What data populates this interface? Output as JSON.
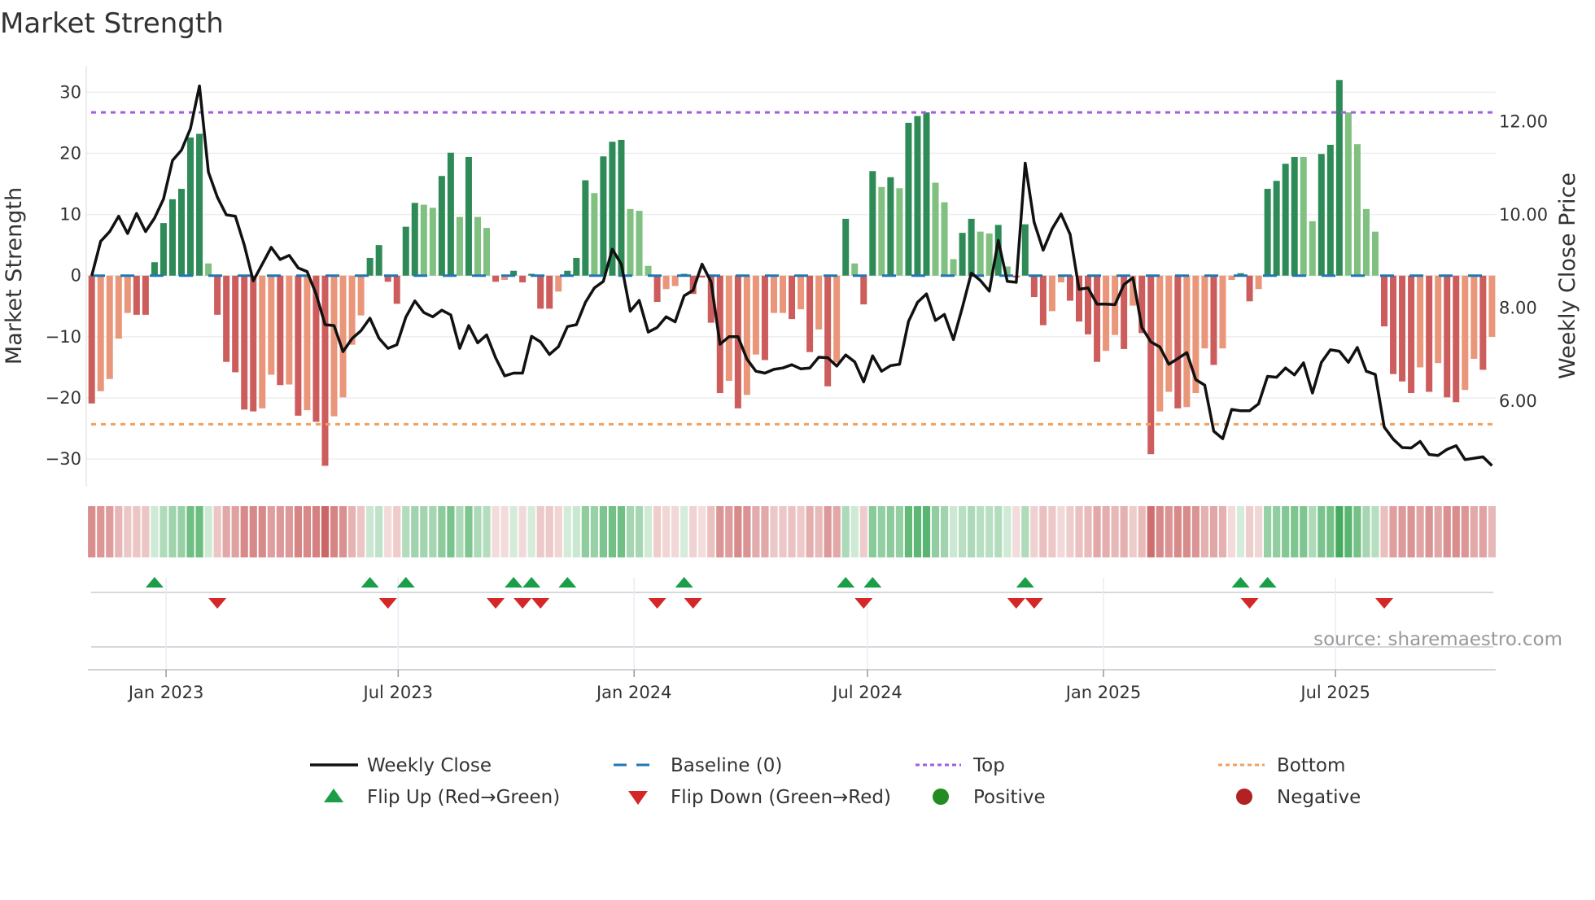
{
  "chart_data": {
    "type": "bar",
    "title": "Market Strength",
    "ylabel": "Market Strength",
    "y2label": "Weekly Close Price",
    "ylim": [
      -34.5,
      34.3
    ],
    "y2lim": [
      4.16,
      13.2
    ],
    "yticks": [
      "30",
      "20",
      "10",
      "0",
      "−10",
      "−20",
      "−30"
    ],
    "ytick_values": [
      30,
      20,
      10,
      0,
      -10,
      -20,
      -30
    ],
    "y2ticks": [
      "12.00",
      "10.00",
      "8.00",
      "6.00"
    ],
    "y2tick_values": [
      12,
      10,
      8,
      6
    ],
    "xticks": [
      "Jan 2023",
      "Jul 2023",
      "Jan 2024",
      "Jul 2024",
      "Jan 2025",
      "Jul 2025"
    ],
    "xtick_dates": [
      "2023-01-01",
      "2023-07-01",
      "2024-01-01",
      "2024-07-01",
      "2025-01-01",
      "2025-07-01"
    ],
    "first_week": "2022-11-04",
    "grid": true,
    "top_level": 26.7,
    "bottom_level": -24.3,
    "baseline": 0,
    "strength": [
      -20.9,
      -18.9,
      -16.9,
      -10.3,
      -6.1,
      -6.4,
      -6.4,
      2.2,
      8.6,
      12.5,
      14.2,
      22.6,
      23.2,
      2.0,
      -6.4,
      -14.1,
      -15.8,
      -21.9,
      -22.2,
      -21.7,
      -16.2,
      -17.9,
      -17.8,
      -22.9,
      -22.0,
      -23.9,
      -31.1,
      -23.0,
      -19.9,
      -11.3,
      -6.5,
      2.9,
      5.0,
      -1.0,
      -4.6,
      8.0,
      11.9,
      11.6,
      11.1,
      16.3,
      20.1,
      9.6,
      19.4,
      9.6,
      7.8,
      -1.0,
      -0.7,
      0.8,
      -1.1,
      0.3,
      -5.4,
      -5.4,
      -2.6,
      0.8,
      2.9,
      15.6,
      13.5,
      19.5,
      21.9,
      22.2,
      10.9,
      10.6,
      1.6,
      -4.3,
      -2.2,
      -1.7,
      0.3,
      -3.0,
      -0.3,
      -7.7,
      -19.2,
      -17.2,
      -21.7,
      -19.5,
      -12.9,
      -13.8,
      -6.1,
      -6.1,
      -7.1,
      -5.5,
      -12.5,
      -8.8,
      -18.1,
      -14.2,
      9.3,
      2.0,
      -4.7,
      17.1,
      14.5,
      16.1,
      14.3,
      25.0,
      26.1,
      26.7,
      15.2,
      12.0,
      2.7,
      7.0,
      9.3,
      7.2,
      6.9,
      8.3,
      1.5,
      -0.3,
      8.4,
      -3.5,
      -8.1,
      -5.8,
      -1.1,
      -4.1,
      -7.5,
      -9.6,
      -14.1,
      -12.3,
      -9.7,
      -12.0,
      -4.9,
      -9.4,
      -29.2,
      -22.2,
      -19.0,
      -21.7,
      -21.5,
      -19.2,
      -11.9,
      -14.6,
      -11.9,
      -0.7,
      0.4,
      -4.2,
      -2.2,
      14.2,
      15.5,
      18.3,
      19.4,
      19.4,
      8.9,
      19.9,
      21.4,
      32.0,
      26.7,
      21.5,
      10.9,
      7.2,
      -8.3,
      -16.1,
      -17.3,
      -19.2,
      -15.0,
      -19.0,
      -14.3,
      -19.9,
      -20.7,
      -18.7,
      -13.6,
      -15.4,
      -10.0
    ],
    "strength_shade": "DLLLLDDDDDDDDLDDDDDLLDLDLDDLLLLDDDDDDLLDDLDLLDLDDDDDLDDDLDDDLLLDLLDDDDDLDLLDLLDLDLDLDLDDLDLDDDLLLDDLLDLDDDDLLDDDDLLDLDDLLDLLLDLLDDLDDDDLLDDDLLLLDDDDLDLDDLLDL",
    "weekly_close": [
      8.69,
      9.43,
      9.64,
      9.97,
      9.6,
      10.03,
      9.64,
      9.93,
      10.34,
      11.17,
      11.39,
      11.85,
      12.77,
      10.92,
      10.38,
      10.0,
      9.97,
      9.35,
      8.58,
      8.94,
      9.3,
      9.04,
      9.13,
      8.86,
      8.78,
      8.3,
      7.64,
      7.62,
      7.06,
      7.34,
      7.51,
      7.78,
      7.35,
      7.13,
      7.21,
      7.8,
      8.15,
      7.9,
      7.81,
      7.95,
      7.85,
      7.13,
      7.62,
      7.25,
      7.42,
      6.93,
      6.54,
      6.6,
      6.6,
      7.39,
      7.27,
      7.0,
      7.17,
      7.6,
      7.64,
      8.12,
      8.43,
      8.57,
      9.26,
      8.94,
      7.93,
      8.16,
      7.48,
      7.58,
      7.81,
      7.7,
      8.26,
      8.38,
      8.94,
      8.56,
      7.22,
      7.38,
      7.38,
      6.9,
      6.64,
      6.6,
      6.68,
      6.71,
      6.78,
      6.69,
      6.71,
      6.94,
      6.93,
      6.75,
      6.99,
      6.84,
      6.41,
      6.97,
      6.64,
      6.76,
      6.79,
      7.71,
      8.12,
      8.3,
      7.73,
      7.86,
      7.32,
      8.01,
      8.75,
      8.59,
      8.36,
      9.45,
      8.57,
      8.55,
      11.11,
      9.84,
      9.24,
      9.7,
      10.02,
      9.58,
      8.4,
      8.43,
      8.08,
      8.08,
      8.07,
      8.5,
      8.65,
      7.58,
      7.27,
      7.16,
      6.79,
      6.91,
      7.04,
      6.46,
      6.34,
      5.35,
      5.19,
      5.82,
      5.79,
      5.79,
      5.94,
      6.53,
      6.51,
      6.71,
      6.56,
      6.82,
      6.17,
      6.83,
      7.1,
      7.07,
      6.83,
      7.15,
      6.64,
      6.57,
      5.44,
      5.18,
      5.0,
      4.99,
      5.13,
      4.85,
      4.83,
      4.96,
      5.04,
      4.74,
      4.77,
      4.8,
      4.61
    ],
    "flip_up_weeks": [
      8,
      32,
      36,
      48,
      50,
      54,
      67,
      85,
      88,
      105,
      129,
      132
    ],
    "flip_down_weeks": [
      15,
      34,
      46,
      49,
      51,
      64,
      68,
      87,
      104,
      106,
      130,
      145
    ],
    "legend": {
      "placement": "bottom",
      "items": [
        "Weekly Close",
        "Baseline (0)",
        "Top",
        "Bottom",
        "Flip Up (Red→Green)",
        "Flip Down (Green→Red)",
        "Positive",
        "Negative"
      ]
    },
    "source": "source: sharemaestro.com",
    "colors": {
      "pos_dark": "#2e8b57",
      "pos_light": "#80c080",
      "neg_dark": "#cd5c5c",
      "neg_light": "#e9967a",
      "price": "#111111",
      "baseline": "#1f77b4",
      "top": "#a35fdc",
      "bottom": "#f0a060",
      "flip_up": "#1a9e48",
      "flip_down": "#d62728",
      "positive": "#228b22",
      "negative": "#b22222",
      "strip_pos": "#3aa655",
      "strip_neg": "#c85a5a"
    }
  }
}
